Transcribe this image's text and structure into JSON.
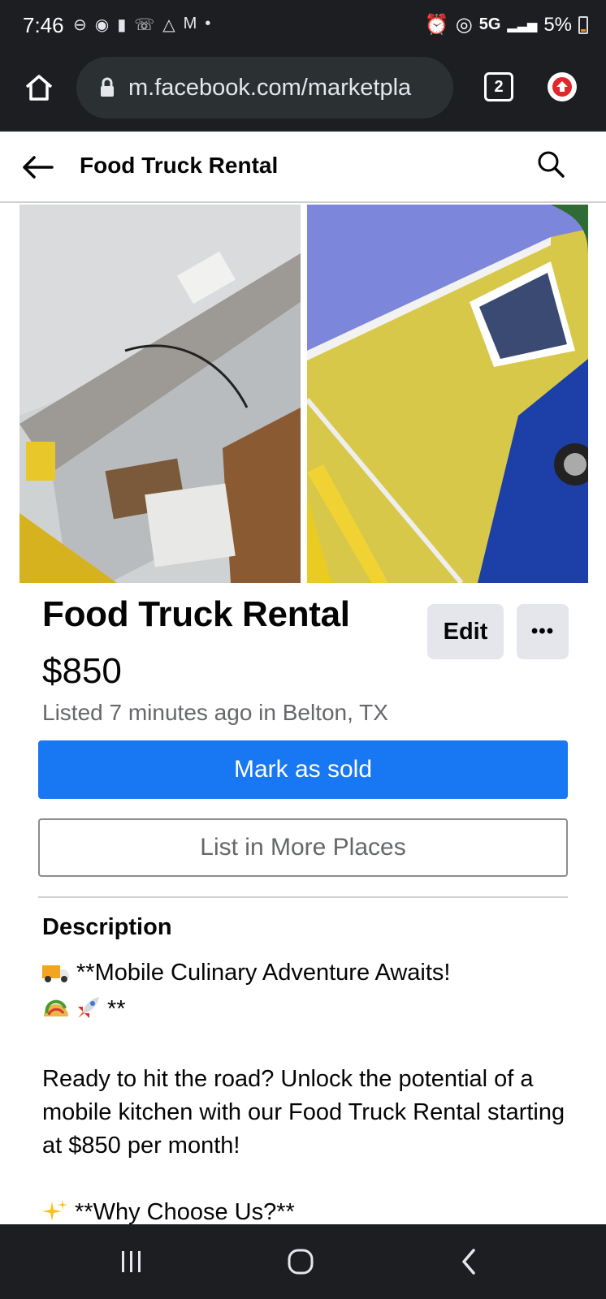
{
  "status_bar": {
    "time": "7:46",
    "network": "5G",
    "battery": "5%"
  },
  "browser": {
    "url": "m.facebook.com/marketpla",
    "tab_count": "2"
  },
  "header": {
    "title": "Food Truck Rental"
  },
  "listing": {
    "title": "Food Truck Rental",
    "price": "$850",
    "meta": "Listed 7 minutes ago in Belton, TX",
    "edit_label": "Edit",
    "more_label": "•••",
    "mark_sold_label": "Mark as sold",
    "list_more_label": "List in More Places"
  },
  "description": {
    "heading": "Description",
    "line1": "**Mobile Culinary Adventure Awaits!",
    "line2": "**",
    "para2": "Ready to hit the road? Unlock the potential of a mobile kitchen with our Food Truck Rental starting at $850 per month!",
    "line3": "**Why Choose Us?**"
  },
  "colors": {
    "accent": "#1877f2",
    "dark_bar": "#1c1e21",
    "secondary_text": "#65676b",
    "button_grey": "#e4e6eb"
  },
  "icons": {
    "home": "home-icon",
    "lock": "lock-icon",
    "tabs": "tabs-icon",
    "update": "update-icon",
    "back": "back-arrow-icon",
    "search": "search-icon",
    "nav_recents": "recents-icon",
    "nav_home": "nav-home-icon",
    "nav_back": "nav-back-icon"
  }
}
